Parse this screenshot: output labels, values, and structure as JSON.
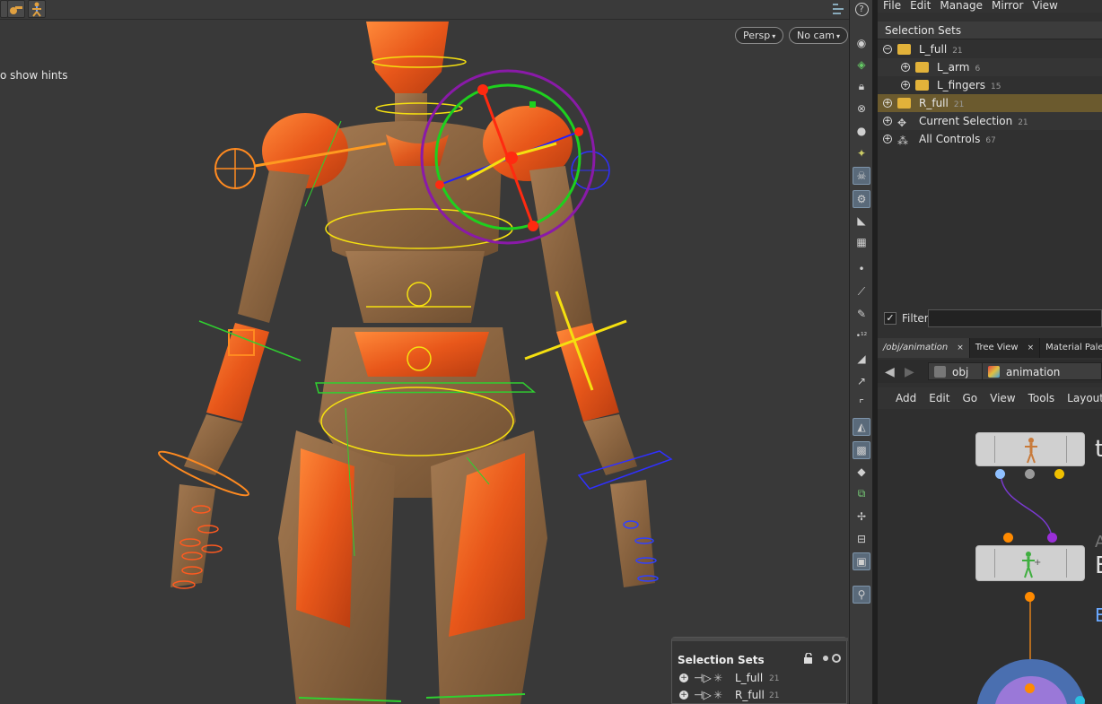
{
  "viewport": {
    "hint": "o show hints",
    "persp_label": "Persp",
    "cam_label": "No cam",
    "help_glyph": "?"
  },
  "menubar": [
    "File",
    "Edit",
    "Manage",
    "Mirror",
    "View"
  ],
  "selection_panel": {
    "header": "Selection Sets",
    "items": [
      {
        "label": "L_full",
        "count": "21",
        "expander": "−"
      },
      {
        "label": "L_arm",
        "count": "6",
        "expander": "+"
      },
      {
        "label": "L_fingers",
        "count": "15",
        "expander": "+"
      },
      {
        "label": "R_full",
        "count": "21",
        "expander": "+"
      },
      {
        "label": "Current Selection",
        "count": "21",
        "expander": "+"
      },
      {
        "label": "All Controls",
        "count": "67",
        "expander": "+"
      }
    ]
  },
  "filter": {
    "label": "Filter",
    "checked": "✓",
    "value": ""
  },
  "tabs": [
    {
      "label": "/obj/animation",
      "close": "×"
    },
    {
      "label": "Tree View",
      "close": "×"
    },
    {
      "label": "Material Palette",
      "close": ""
    }
  ],
  "path": {
    "root": "obj",
    "current": "animation"
  },
  "network_menu": [
    "Add",
    "Edit",
    "Go",
    "View",
    "Tools",
    "Layout"
  ],
  "network": {
    "node1_side": "t",
    "node2_side_a": "A",
    "node2_side_b": "E",
    "node2_side_c": "E"
  },
  "floating_sets": {
    "title": "Selection Sets",
    "rows": [
      {
        "label": "L_full",
        "count": "21"
      },
      {
        "label": "R_full",
        "count": "21"
      }
    ]
  },
  "colors": {
    "accent_highlight": "#6b5a2e",
    "folder": "#e2b23a",
    "selected_tool": "#5a6a7a",
    "node_body": "#d0d0d0",
    "port_blue": "#8fc0ff",
    "port_grey": "#9a9a9a",
    "port_yellow": "#f0c000",
    "port_orange": "#ff8a00",
    "port_purple": "#9a2fd8",
    "wire_purple": "#7a3ad0",
    "wire_orange": "#e0801a"
  }
}
